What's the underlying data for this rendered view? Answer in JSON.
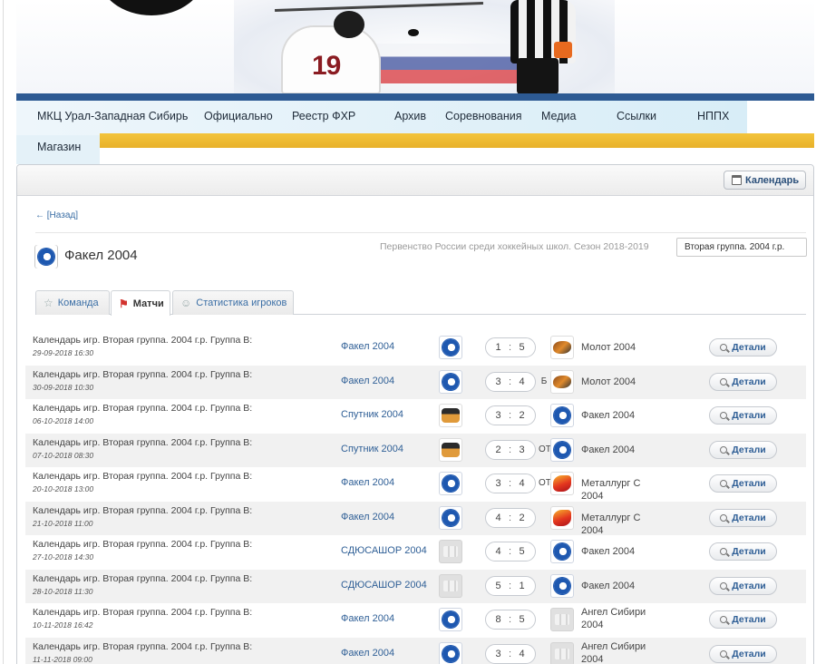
{
  "nav": {
    "items": [
      "МКЦ Урал-Западная Сибирь",
      "Официально",
      "Реестр ФХР",
      "Архив",
      "Соревнования",
      "Медиа",
      "Ссылки",
      "НППХ"
    ],
    "shop": "Магазин"
  },
  "banner": {
    "jersey_number": "19"
  },
  "toolbar": {
    "calendar_label": "Календарь"
  },
  "back_link": "← [Назад]",
  "team": {
    "name": "Факел 2004"
  },
  "season": "Первенство России среди хоккейных школ. Сезон 2018-2019",
  "group_select": {
    "value": "Вторая группа. 2004 г.р."
  },
  "tabs": [
    {
      "label": "Команда",
      "icon": "star-icon",
      "active": false
    },
    {
      "label": "Матчи",
      "icon": "flag-icon",
      "active": true
    },
    {
      "label": "Статистика игроков",
      "icon": "players-icon",
      "active": false
    }
  ],
  "matches": [
    {
      "title": "Календарь игр. Вторая группа. 2004 г.р. Группа В:",
      "date": "29-09-2018 16:30",
      "home": "Факел 2004",
      "home_logo": "fakel",
      "score_home": "1",
      "score_away": "5",
      "suffix": "",
      "away": "Молот 2004",
      "away_logo": "molot",
      "details": "Детали"
    },
    {
      "title": "Календарь игр. Вторая группа. 2004 г.р. Группа В:",
      "date": "30-09-2018 10:30",
      "home": "Факел 2004",
      "home_logo": "fakel",
      "score_home": "3",
      "score_away": "4",
      "suffix": "Б",
      "away": "Молот 2004",
      "away_logo": "molot",
      "details": "Детали"
    },
    {
      "title": "Календарь игр. Вторая группа. 2004 г.р. Группа В:",
      "date": "06-10-2018 14:00",
      "home": "Спутник 2004",
      "home_logo": "sputnik",
      "score_home": "3",
      "score_away": "2",
      "suffix": "",
      "away": "Факел 2004",
      "away_logo": "fakel",
      "details": "Детали"
    },
    {
      "title": "Календарь игр. Вторая группа. 2004 г.р. Группа В:",
      "date": "07-10-2018 08:30",
      "home": "Спутник 2004",
      "home_logo": "sputnik",
      "score_home": "2",
      "score_away": "3",
      "suffix": "ОТ",
      "away": "Факел 2004",
      "away_logo": "fakel",
      "details": "Детали"
    },
    {
      "title": "Календарь игр. Вторая группа. 2004 г.р. Группа В:",
      "date": "20-10-2018 13:00",
      "home": "Факел 2004",
      "home_logo": "fakel",
      "score_home": "3",
      "score_away": "4",
      "suffix": "ОТ",
      "away": "Металлург С 2004",
      "away_logo": "metal",
      "details": "Детали"
    },
    {
      "title": "Календарь игр. Вторая группа. 2004 г.р. Группа В:",
      "date": "21-10-2018 11:00",
      "home": "Факел 2004",
      "home_logo": "fakel",
      "score_home": "4",
      "score_away": "2",
      "suffix": "",
      "away": "Металлург С 2004",
      "away_logo": "metal",
      "details": "Детали"
    },
    {
      "title": "Календарь игр. Вторая группа. 2004 г.р. Группа В:",
      "date": "27-10-2018 14:30",
      "home": "СДЮСАШОР 2004",
      "home_logo": "gray",
      "score_home": "4",
      "score_away": "5",
      "suffix": "",
      "away": "Факел 2004",
      "away_logo": "fakel",
      "details": "Детали"
    },
    {
      "title": "Календарь игр. Вторая группа. 2004 г.р. Группа В:",
      "date": "28-10-2018 11:30",
      "home": "СДЮСАШОР 2004",
      "home_logo": "gray",
      "score_home": "5",
      "score_away": "1",
      "suffix": "",
      "away": "Факел 2004",
      "away_logo": "fakel",
      "details": "Детали"
    },
    {
      "title": "Календарь игр. Вторая группа. 2004 г.р. Группа В:",
      "date": "10-11-2018 16:42",
      "home": "Факел 2004",
      "home_logo": "fakel",
      "score_home": "8",
      "score_away": "5",
      "suffix": "",
      "away": "Ангел Сибири 2004",
      "away_logo": "gray",
      "details": "Детали"
    },
    {
      "title": "Календарь игр. Вторая группа. 2004 г.р. Группа В:",
      "date": "11-11-2018 09:00",
      "home": "Факел 2004",
      "home_logo": "fakel",
      "score_home": "3",
      "score_away": "4",
      "suffix": "",
      "away": "Ангел Сибири 2004",
      "away_logo": "gray",
      "details": "Детали"
    }
  ]
}
